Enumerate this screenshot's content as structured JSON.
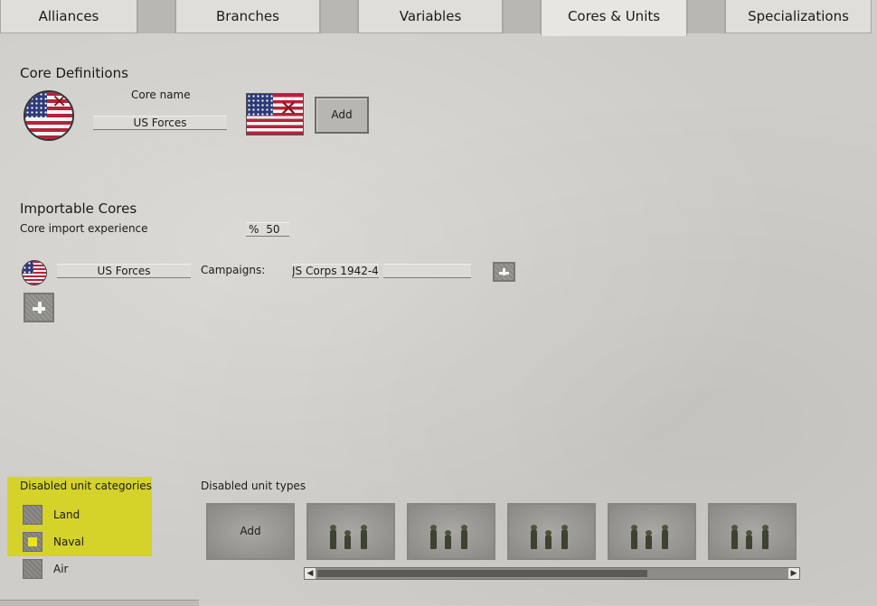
{
  "tabs": [
    {
      "label": "Alliances",
      "active": false
    },
    {
      "label": "Branches",
      "active": false
    },
    {
      "label": "Variables",
      "active": false
    },
    {
      "label": "Cores & Units",
      "active": true
    },
    {
      "label": "Specializations",
      "active": false
    }
  ],
  "core_definitions": {
    "title": "Core Definitions",
    "core_name_label": "Core name",
    "core_name_value": "US Forces",
    "add_label": "Add"
  },
  "importable_cores": {
    "title": "Importable Cores",
    "import_experience_label": "Core import experience",
    "import_experience_prefix": "%",
    "import_experience_value": "50",
    "row": {
      "core_name": "US Forces",
      "campaigns_label": "Campaigns:",
      "campaign_value": "JS Corps 1942-4:",
      "campaign_value_2": ""
    }
  },
  "disabled_unit_categories": {
    "title": "Disabled unit categories",
    "items": [
      {
        "label": "Land",
        "checked": false
      },
      {
        "label": "Naval",
        "checked": true
      },
      {
        "label": "Air",
        "checked": false
      }
    ]
  },
  "disabled_unit_types": {
    "title": "Disabled unit types",
    "add_label": "Add",
    "unit_count": 5
  },
  "icons": {
    "flag": "us-flag-icon",
    "plus": "plus-icon"
  },
  "colors": {
    "highlight": "#d5d22a",
    "checkbox_checked": "#e8e41d"
  }
}
